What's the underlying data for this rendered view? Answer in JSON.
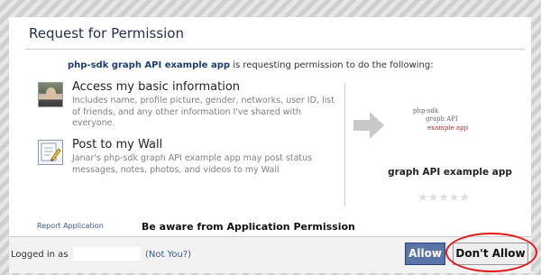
{
  "dialog": {
    "title": "Request for Permission"
  },
  "intro": {
    "app_name": "php-sdk graph API example app",
    "text": " is requesting permission to do the following:"
  },
  "permissions": [
    {
      "icon": "user-photo-icon",
      "title": "Access my basic information",
      "description": "Includes name, profile picture, gender, networks, user ID, list of friends, and any other information I've shared with everyone."
    },
    {
      "icon": "wall-post-icon",
      "title": "Post to my Wall",
      "description": "Janar's php-sdk graph API example app may post status messages, notes, photos, and videos to my Wall"
    }
  ],
  "app_logo": {
    "line1": "php-sdk",
    "line2": "graph API",
    "line3": "example app",
    "accent_color": "#b03030"
  },
  "app_card": {
    "name": "graph API example app",
    "rating_stars": "★★★★★"
  },
  "links": {
    "report": "Report Application"
  },
  "annotation": {
    "text": "Be aware from Application Permission",
    "highlight_color": "#e1191b"
  },
  "footer": {
    "logged_in_label": "Logged in as",
    "not_you": "(Not You?)"
  },
  "buttons": {
    "allow": "Allow",
    "deny": "Don't Allow"
  },
  "colors": {
    "brand_blue": "#3b5998",
    "allow_button": "#5b74a8"
  }
}
